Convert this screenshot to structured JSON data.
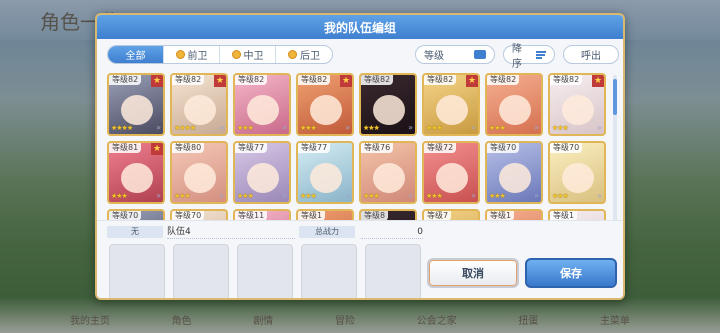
{
  "background": {
    "logo": "角色一览",
    "nav": [
      "我的主页",
      "角色",
      "剧情",
      "冒险",
      "公会之家",
      "扭蛋",
      "主菜单"
    ]
  },
  "dialog": {
    "title": "我的队伍编组",
    "close_icon": "close-icon"
  },
  "filters": {
    "tabs": [
      {
        "label": "全部",
        "active": true
      },
      {
        "label": "前卫",
        "active": false
      },
      {
        "label": "中卫",
        "active": false
      },
      {
        "label": "后卫",
        "active": false
      }
    ],
    "sort_field": "等级",
    "sort_order": "降序",
    "call_out": "呼出"
  },
  "characters": [
    {
      "level": "等级82",
      "stars": "★★★★",
      "fav": true
    },
    {
      "level": "等级82",
      "stars": "★★★★",
      "fav": true
    },
    {
      "level": "等级82",
      "stars": "★★★",
      "fav": false
    },
    {
      "level": "等级82",
      "stars": "★★★",
      "fav": true
    },
    {
      "level": "等级82",
      "stars": "★★★",
      "fav": false
    },
    {
      "level": "等级82",
      "stars": "★★★",
      "fav": true
    },
    {
      "level": "等级82",
      "stars": "★★★",
      "fav": false
    },
    {
      "level": "等级82",
      "stars": "★★★",
      "fav": true
    },
    {
      "level": "等级81",
      "stars": "★★★",
      "fav": true
    },
    {
      "level": "等级80",
      "stars": "★★★",
      "fav": false
    },
    {
      "level": "等级77",
      "stars": "★★★",
      "fav": false
    },
    {
      "level": "等级77",
      "stars": "★★★",
      "fav": false
    },
    {
      "level": "等级76",
      "stars": "★★★",
      "fav": false
    },
    {
      "level": "等级72",
      "stars": "★★★",
      "fav": false
    },
    {
      "level": "等级70",
      "stars": "★★★",
      "fav": false
    },
    {
      "level": "等级70",
      "stars": "★★★",
      "fav": false
    },
    {
      "level": "等级70",
      "stars": "",
      "fav": false
    },
    {
      "level": "等级70",
      "stars": "",
      "fav": false
    },
    {
      "level": "等级11",
      "stars": "",
      "fav": false
    },
    {
      "level": "等级1",
      "stars": "",
      "fav": false
    },
    {
      "level": "等级8",
      "stars": "",
      "fav": false
    },
    {
      "level": "等级7",
      "stars": "",
      "fav": false
    },
    {
      "level": "等级1",
      "stars": "",
      "fav": false
    },
    {
      "level": "等级1",
      "stars": "",
      "fav": false
    }
  ],
  "team": {
    "type_label": "无",
    "name": "队伍4",
    "power_label": "总战力",
    "power_value": "0"
  },
  "buttons": {
    "cancel": "取消",
    "save": "保存"
  }
}
